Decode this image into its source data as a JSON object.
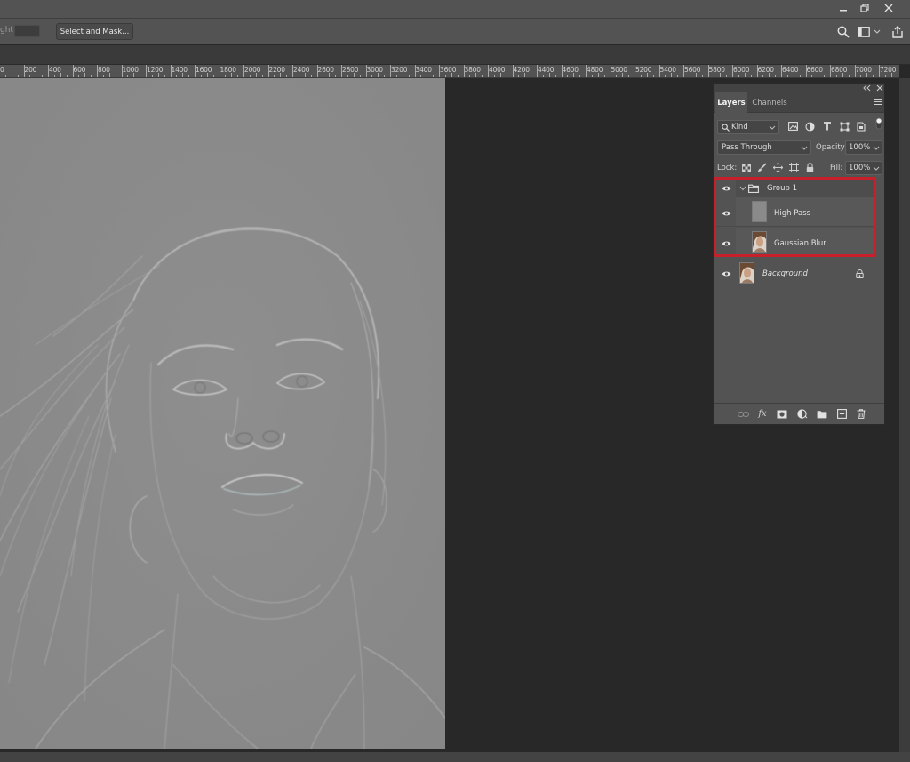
{
  "options_bar": {
    "truncated_label": "ght:",
    "select_and_mask_label": "Select and Mask..."
  },
  "ruler": {
    "labels": [
      "0",
      "200",
      "400",
      "600",
      "800",
      "1000",
      "1200",
      "1400",
      "1600",
      "1800",
      "2000",
      "2200",
      "2400",
      "2600",
      "2800",
      "3000",
      "3200",
      "3400",
      "3600",
      "3800",
      "4000",
      "4200",
      "4400",
      "4600",
      "4800",
      "5000",
      "5200",
      "5400",
      "5600",
      "5800",
      "6000",
      "6200",
      "6400",
      "6600",
      "6800",
      "7000",
      "7200"
    ]
  },
  "layers_panel": {
    "tabs": [
      {
        "label": "Layers",
        "active": true
      },
      {
        "label": "Channels",
        "active": false
      }
    ],
    "filter": {
      "value": "Kind"
    },
    "blend_mode": {
      "value": "Pass Through"
    },
    "opacity": {
      "label": "Opacity:",
      "value": "100%"
    },
    "lock": {
      "label": "Lock:"
    },
    "fill": {
      "label": "Fill:",
      "value": "100%"
    },
    "layers": [
      {
        "name": "Group 1",
        "type": "group",
        "visible": true,
        "expanded": true
      },
      {
        "name": "High Pass",
        "type": "layer",
        "visible": true
      },
      {
        "name": "Gaussian Blur",
        "type": "layer",
        "visible": true
      },
      {
        "name": "Background",
        "type": "background",
        "visible": true,
        "locked": true
      }
    ],
    "footer_icons": [
      "link-icon",
      "fx-icon",
      "mask-icon",
      "adjustment-icon",
      "folder-icon",
      "new-layer-icon",
      "trash-icon"
    ]
  },
  "colors": {
    "highlight": "#c8202b",
    "panel_bg": "#535353",
    "canvas_bg": "#282828",
    "image_gray": "#8b8b8b"
  }
}
